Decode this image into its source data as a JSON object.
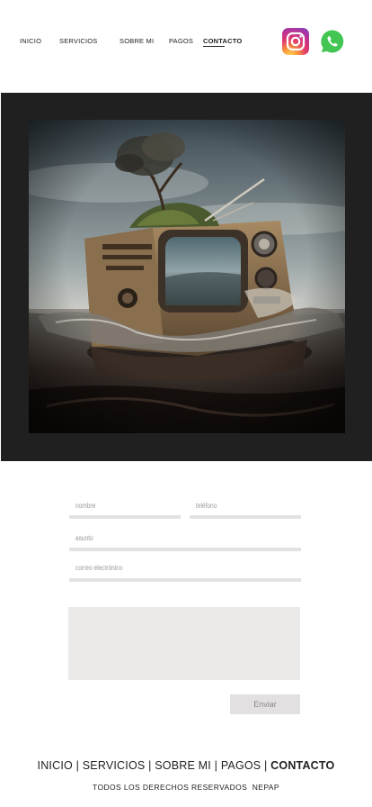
{
  "nav": {
    "items": [
      {
        "label": "INICIO"
      },
      {
        "label": "SERVICIOS"
      },
      {
        "label": "SOBRE MI"
      },
      {
        "label": "PAGOS"
      },
      {
        "label": "CONTACTO",
        "active": true
      }
    ]
  },
  "social": {
    "instagram_icon": "instagram-icon",
    "whatsapp_icon": "whatsapp-icon",
    "instagram_colors": [
      "#fdd35b",
      "#e23c6b",
      "#7f3fc7"
    ],
    "whatsapp_color": "#43c553"
  },
  "hero": {
    "frame_color": "#202020",
    "image_subject": "vintage television in the sea with a tree growing on top"
  },
  "form": {
    "name_placeholder": "nombre",
    "phone_placeholder": "teléfono",
    "subject_placeholder": "asunto",
    "email_placeholder": "correo electrónico",
    "message_placeholder": "",
    "submit_label": "Enviar"
  },
  "footer": {
    "links": [
      "INICIO",
      "SERVICIOS",
      "SOBRE MI",
      "PAGOS",
      "CONTACTO"
    ],
    "separator": "|",
    "copyright": "TODOS LOS DERECHOS RESERVADOS  NEPAP"
  }
}
